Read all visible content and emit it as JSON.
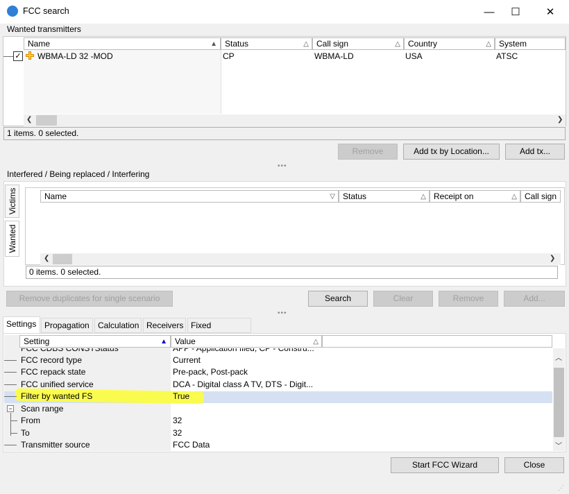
{
  "window": {
    "title": "FCC search",
    "controls": [
      "—",
      "☐",
      "✕"
    ]
  },
  "wanted": {
    "group_label": "Wanted transmitters",
    "columns": [
      "Name",
      "Status",
      "Call sign",
      "Country",
      "System"
    ],
    "rows": [
      {
        "checked": true,
        "name": "WBMA-LD 32 -MOD",
        "status": "CP",
        "call_sign": "WBMA-LD",
        "country": "USA",
        "system": "ATSC"
      }
    ],
    "status_text": "1 items. 0 selected.",
    "buttons": {
      "remove": "Remove",
      "add_by_location": "Add tx by Location...",
      "add_tx": "Add tx..."
    }
  },
  "interfered": {
    "group_label": "Interfered / Being replaced / Interfering",
    "side_tabs": [
      "Victims",
      "Wanted"
    ],
    "columns": [
      "Name",
      "Status",
      "Receipt on",
      "Call sign"
    ],
    "status_text": "0 items. 0 selected.",
    "buttons": {
      "remove_duplicates": "Remove duplicates for single scenario",
      "search": "Search",
      "clear": "Clear",
      "remove": "Remove",
      "add": "Add..."
    }
  },
  "tabs": [
    "Settings",
    "Propagation",
    "Calculation",
    "Receivers",
    "Fixed reception"
  ],
  "settings": {
    "columns": [
      "Setting",
      "Value"
    ],
    "partial_row": {
      "setting": "FCC CDBS CONSTStatus",
      "value": "APP - Application filed, CP - Constru..."
    },
    "rows": [
      {
        "setting": "FCC record type",
        "value": "Current"
      },
      {
        "setting": "FCC repack state",
        "value": "Pre-pack, Post-pack"
      },
      {
        "setting": "FCC unified service",
        "value": "DCA - Digital class A TV, DTS - Digit..."
      },
      {
        "setting": "Filter by wanted FS",
        "value": "True"
      },
      {
        "setting": "Scan range",
        "value": ""
      },
      {
        "setting": "From",
        "value": "32"
      },
      {
        "setting": "To",
        "value": "32"
      },
      {
        "setting": "Transmitter source",
        "value": "FCC Data"
      }
    ],
    "highlight_color": "#ffff33",
    "selected_row_color": "#d5e1f2"
  },
  "footer": {
    "start_wizard": "Start FCC Wizard",
    "close": "Close"
  }
}
